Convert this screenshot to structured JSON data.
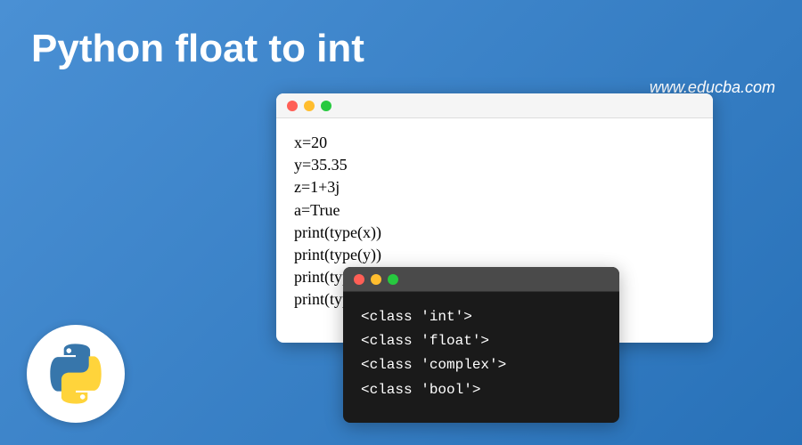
{
  "title": "Python float to int",
  "url": "www.educba.com",
  "code": {
    "line1": "x=20",
    "line2": "y=35.35",
    "line3": "z=1+3j",
    "line4": "a=True",
    "line5": "print(type(x))",
    "line6": "print(type(y))",
    "line7": "print(type(z))",
    "line8": "print(type(a))"
  },
  "terminal": {
    "line1": "<class 'int'>",
    "line2": "<class 'float'>",
    "line3": "<class 'complex'>",
    "line4": "<class 'bool'>"
  }
}
